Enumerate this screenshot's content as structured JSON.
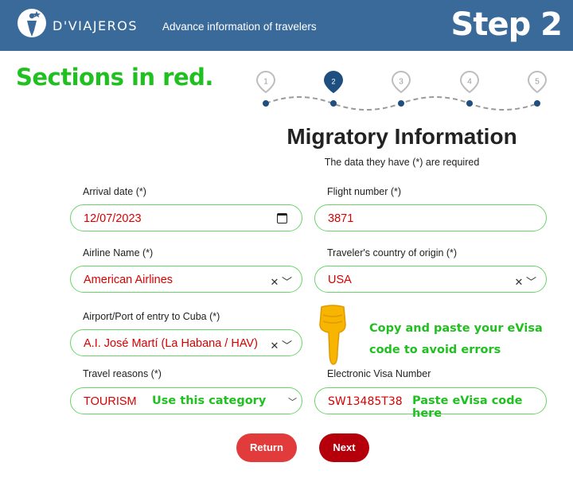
{
  "header": {
    "brand": "D'VIAJEROS",
    "tagline": "Advance information of travelers",
    "step": "Step 2"
  },
  "annotation": {
    "sections_note": "Sections in red.",
    "copy_note": "Copy and paste your eVisa code to avoid errors",
    "reason_hint": "Use this category",
    "visa_hint": "Paste eVisa code here"
  },
  "progress": {
    "steps": [
      "1",
      "2",
      "3",
      "4",
      "5"
    ],
    "current": 2
  },
  "form": {
    "title": "Migratory Information",
    "subtitle": "The data they have (*) are required",
    "arrival_date": {
      "label": "Arrival date (*)",
      "value": "12/07/2023"
    },
    "flight_number": {
      "label": "Flight number (*)",
      "value": "3871"
    },
    "airline": {
      "label": "Airline Name (*)",
      "value": "American Airlines"
    },
    "country_origin": {
      "label": "Traveler's country of origin (*)",
      "value": "USA"
    },
    "airport": {
      "label": "Airport/Port of entry to Cuba (*)",
      "value": "A.I. José Martí (La Habana / HAV)"
    },
    "travel_reasons": {
      "label": "Travel reasons (*)",
      "value": "TOURISM"
    },
    "evisa": {
      "label": "Electronic Visa Number",
      "value": "SW13485T38"
    }
  },
  "buttons": {
    "return": "Return",
    "next": "Next"
  },
  "colors": {
    "header": "#3a6a9a",
    "accent_red": "#d90000",
    "note_green": "#20c020",
    "field_border": "#6ad46a"
  }
}
